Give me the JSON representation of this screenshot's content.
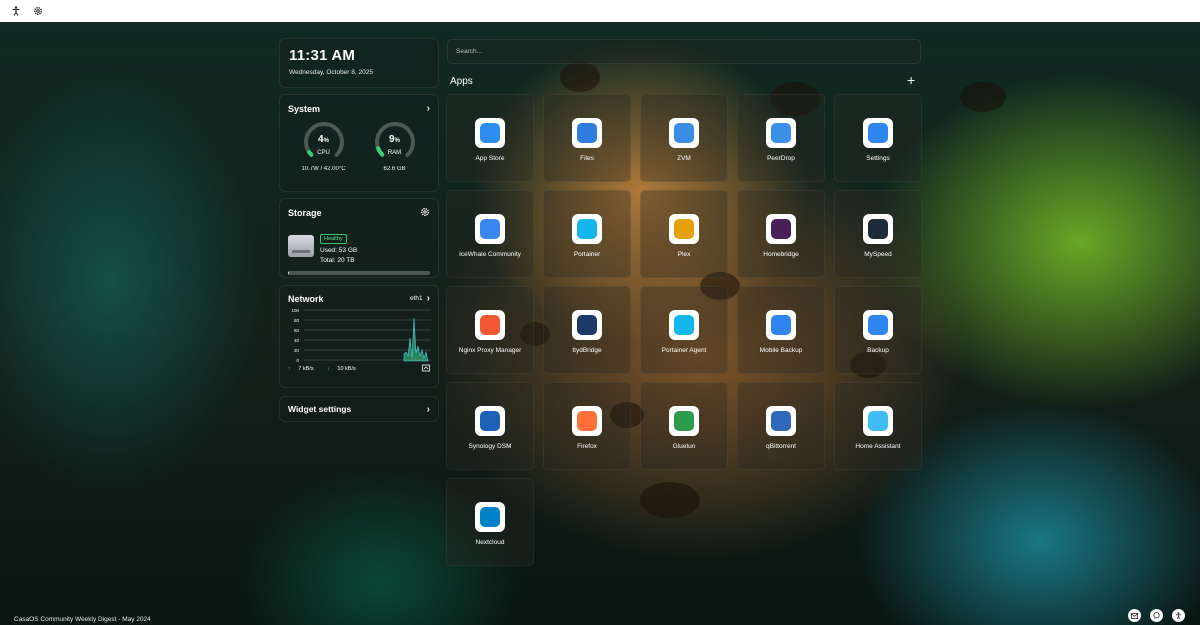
{
  "topbar": {
    "icons": [
      "accessibility-icon",
      "settings-gear-icon"
    ]
  },
  "clock": {
    "time": "11:31 AM",
    "date": "Wednesday, October 8, 2025"
  },
  "system": {
    "title": "System",
    "cpu": {
      "value": "4",
      "unit": "%",
      "label": "CPU",
      "sub": "10.7W / 42.00°C",
      "percent": 4
    },
    "ram": {
      "value": "9",
      "unit": "%",
      "label": "RAM",
      "sub": "62.6 GB",
      "percent": 9
    }
  },
  "storage": {
    "title": "Storage",
    "status": "Healthy",
    "used": "Used: 53 GB",
    "total": "Total: 20 TB",
    "used_fraction": 0.003
  },
  "network": {
    "title": "Network",
    "interface": "eth1",
    "y_ticks": [
      "100",
      "80",
      "60",
      "40",
      "20",
      "0"
    ],
    "upload": "7 kB/s",
    "download": "10 kB/s"
  },
  "widget_settings": {
    "label": "Widget settings"
  },
  "search": {
    "placeholder": "Search..."
  },
  "apps": {
    "title": "Apps",
    "add_label": "+",
    "items": [
      {
        "label": "App Store",
        "icon": "app-store-icon",
        "color": "#2d8cf0"
      },
      {
        "label": "Files",
        "icon": "files-folder-icon",
        "color": "#2f7de1"
      },
      {
        "label": "ZVM",
        "icon": "zvm-monitor-icon",
        "color": "#3a8ee6"
      },
      {
        "label": "PeerDrop",
        "icon": "peerdrop-icon",
        "color": "#3b8fe8"
      },
      {
        "label": "Settings",
        "icon": "settings-chevron-icon",
        "color": "#2f86f0"
      },
      {
        "label": "IceWhale Community",
        "icon": "icewhale-paw-icon",
        "color": "#3a86f0"
      },
      {
        "label": "Portainer",
        "icon": "portainer-crane-icon",
        "color": "#13b5ea"
      },
      {
        "label": "Plex",
        "icon": "plex-chevron-icon",
        "color": "#e5a00d"
      },
      {
        "label": "Homebridge",
        "icon": "homebridge-icon",
        "color": "#491f59"
      },
      {
        "label": "MySpeed",
        "icon": "myspeed-gauge-icon",
        "color": "#1d2a3a"
      },
      {
        "label": "Nginx Proxy Manager",
        "icon": "nginx-proxy-manager-icon",
        "color": "#f15833"
      },
      {
        "label": "ttydBridge",
        "icon": "terminal-icon",
        "color": "#1e3a6b"
      },
      {
        "label": "Portainer Agent",
        "icon": "portainer-agent-icon",
        "color": "#13b5ea"
      },
      {
        "label": "Mobile Backup",
        "icon": "mobile-backup-icon",
        "color": "#2f86f0"
      },
      {
        "label": "Backup",
        "icon": "backup-clock-icon",
        "color": "#2f86f0"
      },
      {
        "label": "Synology DSM",
        "icon": "synology-dsm-icon",
        "color": "#1c63b7"
      },
      {
        "label": "Firefox",
        "icon": "firefox-icon",
        "color": "#ff7139"
      },
      {
        "label": "Gluetun",
        "icon": "gluetun-icon",
        "color": "#2c9b4a"
      },
      {
        "label": "qBittorrent",
        "icon": "qbittorrent-icon",
        "color": "#2f67ba"
      },
      {
        "label": "Home Assistant",
        "icon": "home-assistant-icon",
        "color": "#41bdf5"
      },
      {
        "label": "Nextcloud",
        "icon": "nextcloud-icon",
        "color": "#0082c9"
      }
    ]
  },
  "footer": {
    "text": "CasaOS Community Weekly Digest - May 2024",
    "corner_icons": [
      "mail-icon",
      "chat-icon",
      "person-icon"
    ]
  }
}
